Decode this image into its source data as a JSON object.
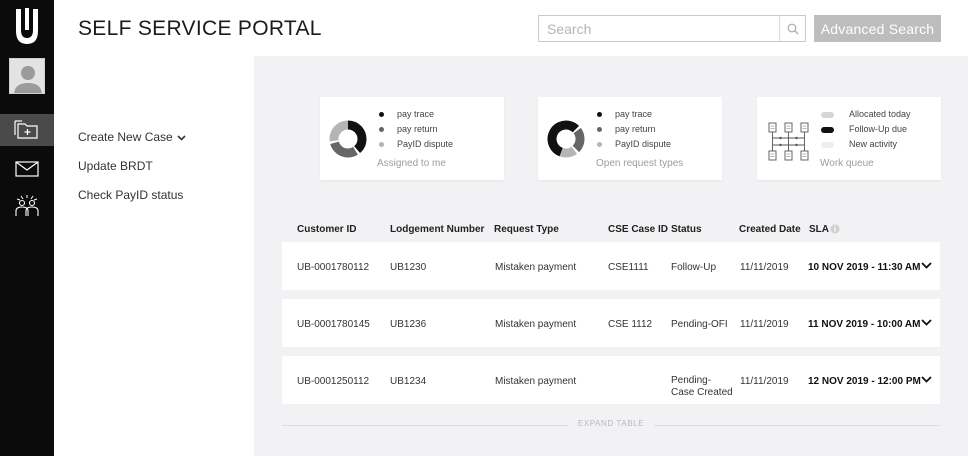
{
  "header": {
    "title": "SELF SERVICE PORTAL",
    "search_placeholder": "Search",
    "advanced_search_label": "Advanced Search"
  },
  "menu": {
    "items": [
      {
        "label": "Create New Case",
        "has_dropdown": true
      },
      {
        "label": "Update BRDT"
      },
      {
        "label": "Check PayID status"
      }
    ]
  },
  "cards": [
    {
      "legend": [
        "pay trace",
        "pay return",
        "PayID dispute"
      ],
      "caption": "Assigned to me",
      "legend_colors": [
        "#111111",
        "#666666",
        "#b5b5b5"
      ]
    },
    {
      "legend": [
        "pay trace",
        "pay return",
        "PayID dispute"
      ],
      "caption": "Open request types",
      "legend_colors": [
        "#111111",
        "#666666",
        "#b5b5b5"
      ]
    },
    {
      "legend": [
        "Allocated today",
        "Follow-Up due",
        "New activity"
      ],
      "caption": "Work queue",
      "legend_colors": [
        "#d6d6d6",
        "#111111",
        "#eeeeee"
      ]
    }
  ],
  "table": {
    "columns": [
      "Customer ID",
      "Lodgement Number",
      "Request Type",
      "CSE Case ID",
      "Status",
      "Created Date",
      "SLA"
    ],
    "rows": [
      {
        "customer_id": "UB-0001780112",
        "lodgement": "UB1230",
        "request_type": "Mistaken payment",
        "cse_case_id": "CSE1111",
        "status_line1": "Follow-Up",
        "status_line2": "",
        "created": "11/11/2019",
        "sla": "10 NOV 2019 - 11:30 AM"
      },
      {
        "customer_id": "UB-0001780145",
        "lodgement": "UB1236",
        "request_type": "Mistaken payment",
        "cse_case_id": "CSE 1112",
        "status_line1": "Pending-OFI",
        "status_line2": "",
        "created": "11/11/2019",
        "sla": "11 NOV 2019 - 10:00 AM"
      },
      {
        "customer_id": "UB-0001250112",
        "lodgement": "UB1234",
        "request_type": "Mistaken payment",
        "cse_case_id": "",
        "status_line1": "Pending-",
        "status_line2": "Case Created",
        "created": "11/11/2019",
        "sla": "12 NOV 2019 - 12:00 PM"
      }
    ],
    "expand_label": "EXPAND TABLE"
  },
  "colors": {
    "rail": "#0b0b0b",
    "rail_active": "#4a4a4a",
    "main_bg": "#f2f2f4",
    "button_disabled": "#bdbdbd"
  },
  "icons": {
    "logo": "u-logo-icon",
    "avatar": "user-avatar-icon",
    "rail": [
      "folder-add-icon",
      "mail-icon",
      "group-people-icon"
    ],
    "search": "search-icon",
    "sla_info": "info-icon",
    "row_expand": "chevron-down-icon"
  }
}
